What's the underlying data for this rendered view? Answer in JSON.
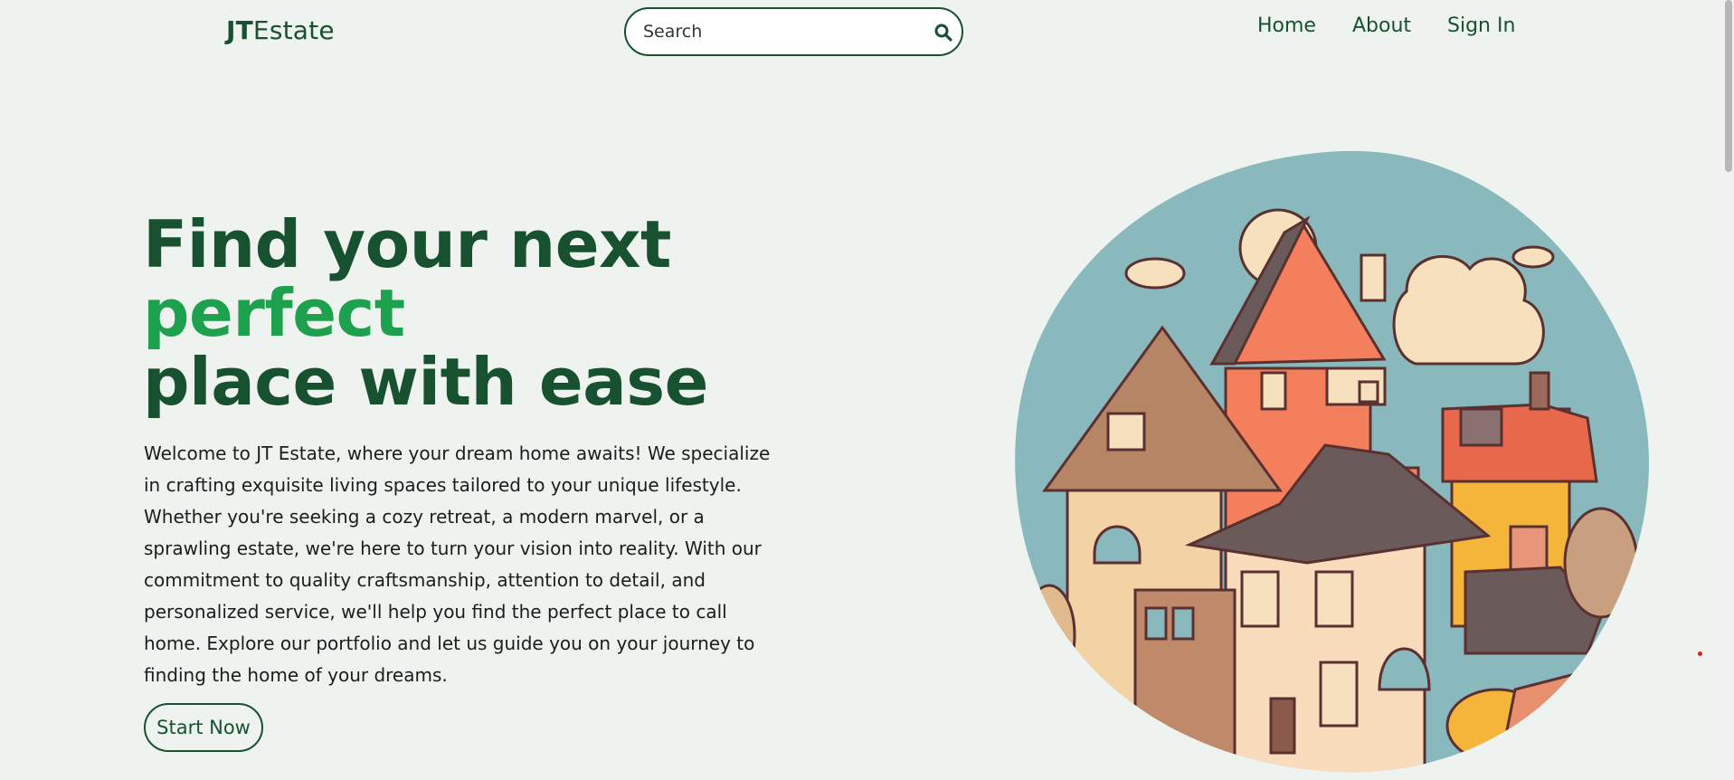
{
  "header": {
    "logo_bold": "JT",
    "logo_rest": "Estate",
    "search_placeholder": "Search",
    "nav": [
      {
        "label": "Home"
      },
      {
        "label": "About"
      },
      {
        "label": "Sign In"
      }
    ]
  },
  "hero": {
    "title_line1": "Find your next",
    "title_accent": "perfect",
    "title_line3": "place with ease",
    "description": "Welcome to JT Estate, where your dream home awaits! We specialize in crafting exquisite living spaces tailored to your unique lifestyle. Whether you're seeking a cozy retreat, a modern marvel, or a sprawling estate, we're here to turn your vision into reality. With our commitment to quality craftsmanship, attention to detail, and personalized service, we'll help you find the perfect place to call home. Explore our portfolio and let us guide you on your journey to finding the home of your dreams.",
    "cta_label": "Start Now"
  },
  "colors": {
    "brand_dark_green": "#18512f",
    "accent_green": "#1ea14e",
    "background": "#eff3ef",
    "illustration_sky": "#8ab9bd"
  },
  "icons": {
    "search": "search-icon",
    "illustration": "houses-illustration"
  }
}
